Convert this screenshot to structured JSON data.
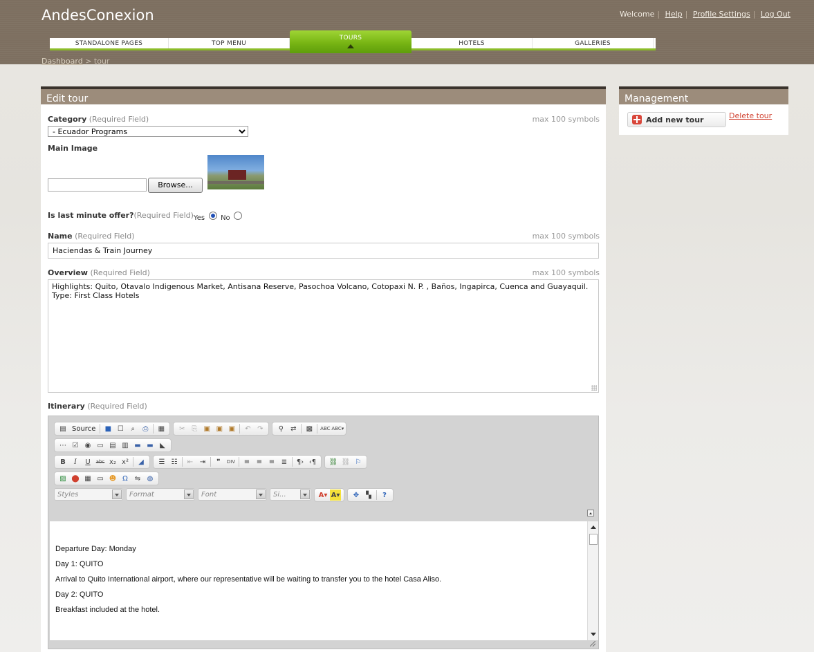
{
  "header": {
    "brand": "AndesConexion",
    "welcome": "Welcome",
    "links": {
      "help": "Help",
      "profile": "Profile Settings",
      "logout": "Log Out"
    }
  },
  "menu": {
    "tabs": [
      {
        "label": "STANDALONE PAGES"
      },
      {
        "label": "TOP MENU"
      },
      {
        "label": "TOURS",
        "active": true
      },
      {
        "label": "HOTELS"
      },
      {
        "label": "GALLERIES"
      }
    ],
    "accent": "#78b514"
  },
  "breadcrumb": {
    "dashboard": "Dashboard",
    "sep": ">",
    "current": "tour"
  },
  "edit_panel": {
    "title": "Edit tour",
    "category": {
      "label": "Category",
      "required": "(Required Field)",
      "max": "max 100 symbols",
      "selected": "- Ecuador Programs"
    },
    "main_image": {
      "label": "Main Image",
      "browse": "Browse...",
      "file_value": ""
    },
    "last_minute": {
      "label": "Is last minute offer?",
      "required": "(Required Field)",
      "yes": "Yes",
      "no": "No",
      "selected": "Yes"
    },
    "name": {
      "label": "Name",
      "required": "(Required Field)",
      "max": "max 100 symbols",
      "value": "Haciendas & Train Journey"
    },
    "overview": {
      "label": "Overview",
      "required": "(Required Field)",
      "max": "max 100 symbols",
      "value": "Highlights: Quito, Otavalo Indigenous Market, Antisana Reserve, Pasochoa Volcano, Cotopaxi N. P. , Baños,  Ingapirca, Cuenca and Guayaquil. Type: First Class Hotels"
    },
    "itinerary": {
      "label": "Itinerary",
      "required": "(Required Field)",
      "toolbar": {
        "source": "Source",
        "styles": "Styles",
        "format": "Format",
        "font": "Font",
        "size": "Si..."
      },
      "content": [
        "Departure Day: Monday",
        "Day 1:  QUITO",
        "Arrival to Quito International airport, where our representative will be waiting to transfer you to the hotel Casa Aliso.",
        "Day 2: QUITO",
        "Breakfast included at the hotel."
      ]
    }
  },
  "management": {
    "title": "Management",
    "add": "Add new tour",
    "delete": "Delete tour"
  }
}
